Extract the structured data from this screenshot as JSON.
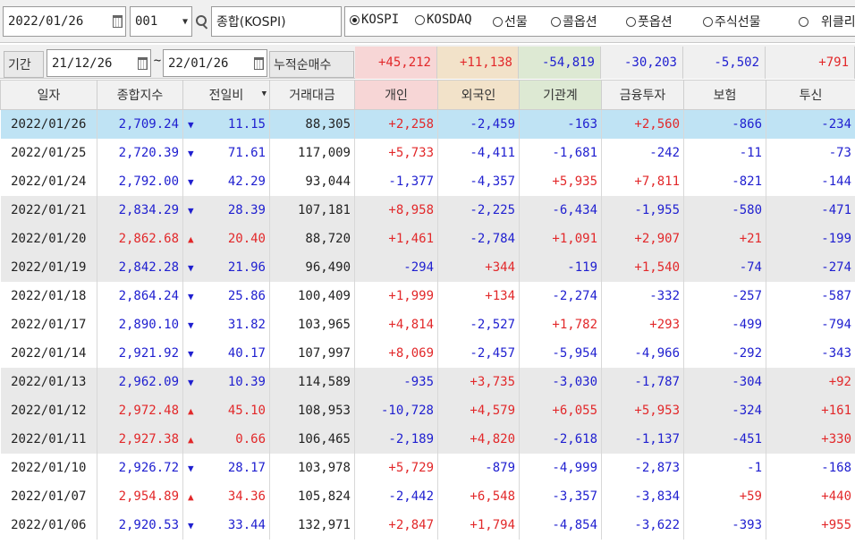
{
  "controls": {
    "date": "2022/01/26",
    "code": "001",
    "name": "종합(KOSPI)"
  },
  "markets": [
    {
      "label": "KOSPI",
      "selected": true
    },
    {
      "label": "KOSDAQ",
      "selected": false
    },
    {
      "label": "선물",
      "selected": false
    },
    {
      "label": "콜옵션",
      "selected": false
    },
    {
      "label": "풋옵션",
      "selected": false
    },
    {
      "label": "주식선물",
      "selected": false
    },
    {
      "label": "위클리",
      "selected": false
    }
  ],
  "period": {
    "label": "기간",
    "from": "21/12/26",
    "tilde": "~",
    "to": "22/01/26",
    "sum_label": "누적순매수",
    "sums": [
      "+45,212",
      "+11,138",
      "-54,819",
      "-30,203",
      "-5,502",
      "+791"
    ]
  },
  "colors": {
    "up": "#e2282a",
    "down": "#2020d0",
    "selected_row": "#bfe3f4",
    "gray_row": "#e9e9e9"
  },
  "headers": {
    "date": "일자",
    "index": "종합지수",
    "change": "전일비",
    "amount": "거래대금",
    "indiv": "개인",
    "foreign": "외국인",
    "inst": "기관계",
    "fin": "금융투자",
    "ins": "보험",
    "trust": "투신"
  },
  "rows": [
    {
      "date": "2022/01/26",
      "index": "2,709.24",
      "dir": "down",
      "change": "11.15",
      "amount": "88,305",
      "indiv": "+2,258",
      "foreign": "-2,459",
      "inst": "-163",
      "fin": "+2,560",
      "ins": "-866",
      "trust": "-234"
    },
    {
      "date": "2022/01/25",
      "index": "2,720.39",
      "dir": "down",
      "change": "71.61",
      "amount": "117,009",
      "indiv": "+5,733",
      "foreign": "-4,411",
      "inst": "-1,681",
      "fin": "-242",
      "ins": "-11",
      "trust": "-73"
    },
    {
      "date": "2022/01/24",
      "index": "2,792.00",
      "dir": "down",
      "change": "42.29",
      "amount": "93,044",
      "indiv": "-1,377",
      "foreign": "-4,357",
      "inst": "+5,935",
      "fin": "+7,811",
      "ins": "-821",
      "trust": "-144"
    },
    {
      "date": "2022/01/21",
      "index": "2,834.29",
      "dir": "down",
      "change": "28.39",
      "amount": "107,181",
      "indiv": "+8,958",
      "foreign": "-2,225",
      "inst": "-6,434",
      "fin": "-1,955",
      "ins": "-580",
      "trust": "-471"
    },
    {
      "date": "2022/01/20",
      "index": "2,862.68",
      "dir": "up",
      "change": "20.40",
      "amount": "88,720",
      "indiv": "+1,461",
      "foreign": "-2,784",
      "inst": "+1,091",
      "fin": "+2,907",
      "ins": "+21",
      "trust": "-199"
    },
    {
      "date": "2022/01/19",
      "index": "2,842.28",
      "dir": "down",
      "change": "21.96",
      "amount": "96,490",
      "indiv": "-294",
      "foreign": "+344",
      "inst": "-119",
      "fin": "+1,540",
      "ins": "-74",
      "trust": "-274"
    },
    {
      "date": "2022/01/18",
      "index": "2,864.24",
      "dir": "down",
      "change": "25.86",
      "amount": "100,409",
      "indiv": "+1,999",
      "foreign": "+134",
      "inst": "-2,274",
      "fin": "-332",
      "ins": "-257",
      "trust": "-587"
    },
    {
      "date": "2022/01/17",
      "index": "2,890.10",
      "dir": "down",
      "change": "31.82",
      "amount": "103,965",
      "indiv": "+4,814",
      "foreign": "-2,527",
      "inst": "+1,782",
      "fin": "+293",
      "ins": "-499",
      "trust": "-794"
    },
    {
      "date": "2022/01/14",
      "index": "2,921.92",
      "dir": "down",
      "change": "40.17",
      "amount": "107,997",
      "indiv": "+8,069",
      "foreign": "-2,457",
      "inst": "-5,954",
      "fin": "-4,966",
      "ins": "-292",
      "trust": "-343"
    },
    {
      "date": "2022/01/13",
      "index": "2,962.09",
      "dir": "down",
      "change": "10.39",
      "amount": "114,589",
      "indiv": "-935",
      "foreign": "+3,735",
      "inst": "-3,030",
      "fin": "-1,787",
      "ins": "-304",
      "trust": "+92"
    },
    {
      "date": "2022/01/12",
      "index": "2,972.48",
      "dir": "up",
      "change": "45.10",
      "amount": "108,953",
      "indiv": "-10,728",
      "foreign": "+4,579",
      "inst": "+6,055",
      "fin": "+5,953",
      "ins": "-324",
      "trust": "+161"
    },
    {
      "date": "2022/01/11",
      "index": "2,927.38",
      "dir": "up",
      "change": "0.66",
      "amount": "106,465",
      "indiv": "-2,189",
      "foreign": "+4,820",
      "inst": "-2,618",
      "fin": "-1,137",
      "ins": "-451",
      "trust": "+330"
    },
    {
      "date": "2022/01/10",
      "index": "2,926.72",
      "dir": "down",
      "change": "28.17",
      "amount": "103,978",
      "indiv": "+5,729",
      "foreign": "-879",
      "inst": "-4,999",
      "fin": "-2,873",
      "ins": "-1",
      "trust": "-168"
    },
    {
      "date": "2022/01/07",
      "index": "2,954.89",
      "dir": "up",
      "change": "34.36",
      "amount": "105,824",
      "indiv": "-2,442",
      "foreign": "+6,548",
      "inst": "-3,357",
      "fin": "-3,834",
      "ins": "+59",
      "trust": "+440"
    },
    {
      "date": "2022/01/06",
      "index": "2,920.53",
      "dir": "down",
      "change": "33.44",
      "amount": "132,971",
      "indiv": "+2,847",
      "foreign": "+1,794",
      "inst": "-4,854",
      "fin": "-3,622",
      "ins": "-393",
      "trust": "+955"
    }
  ]
}
